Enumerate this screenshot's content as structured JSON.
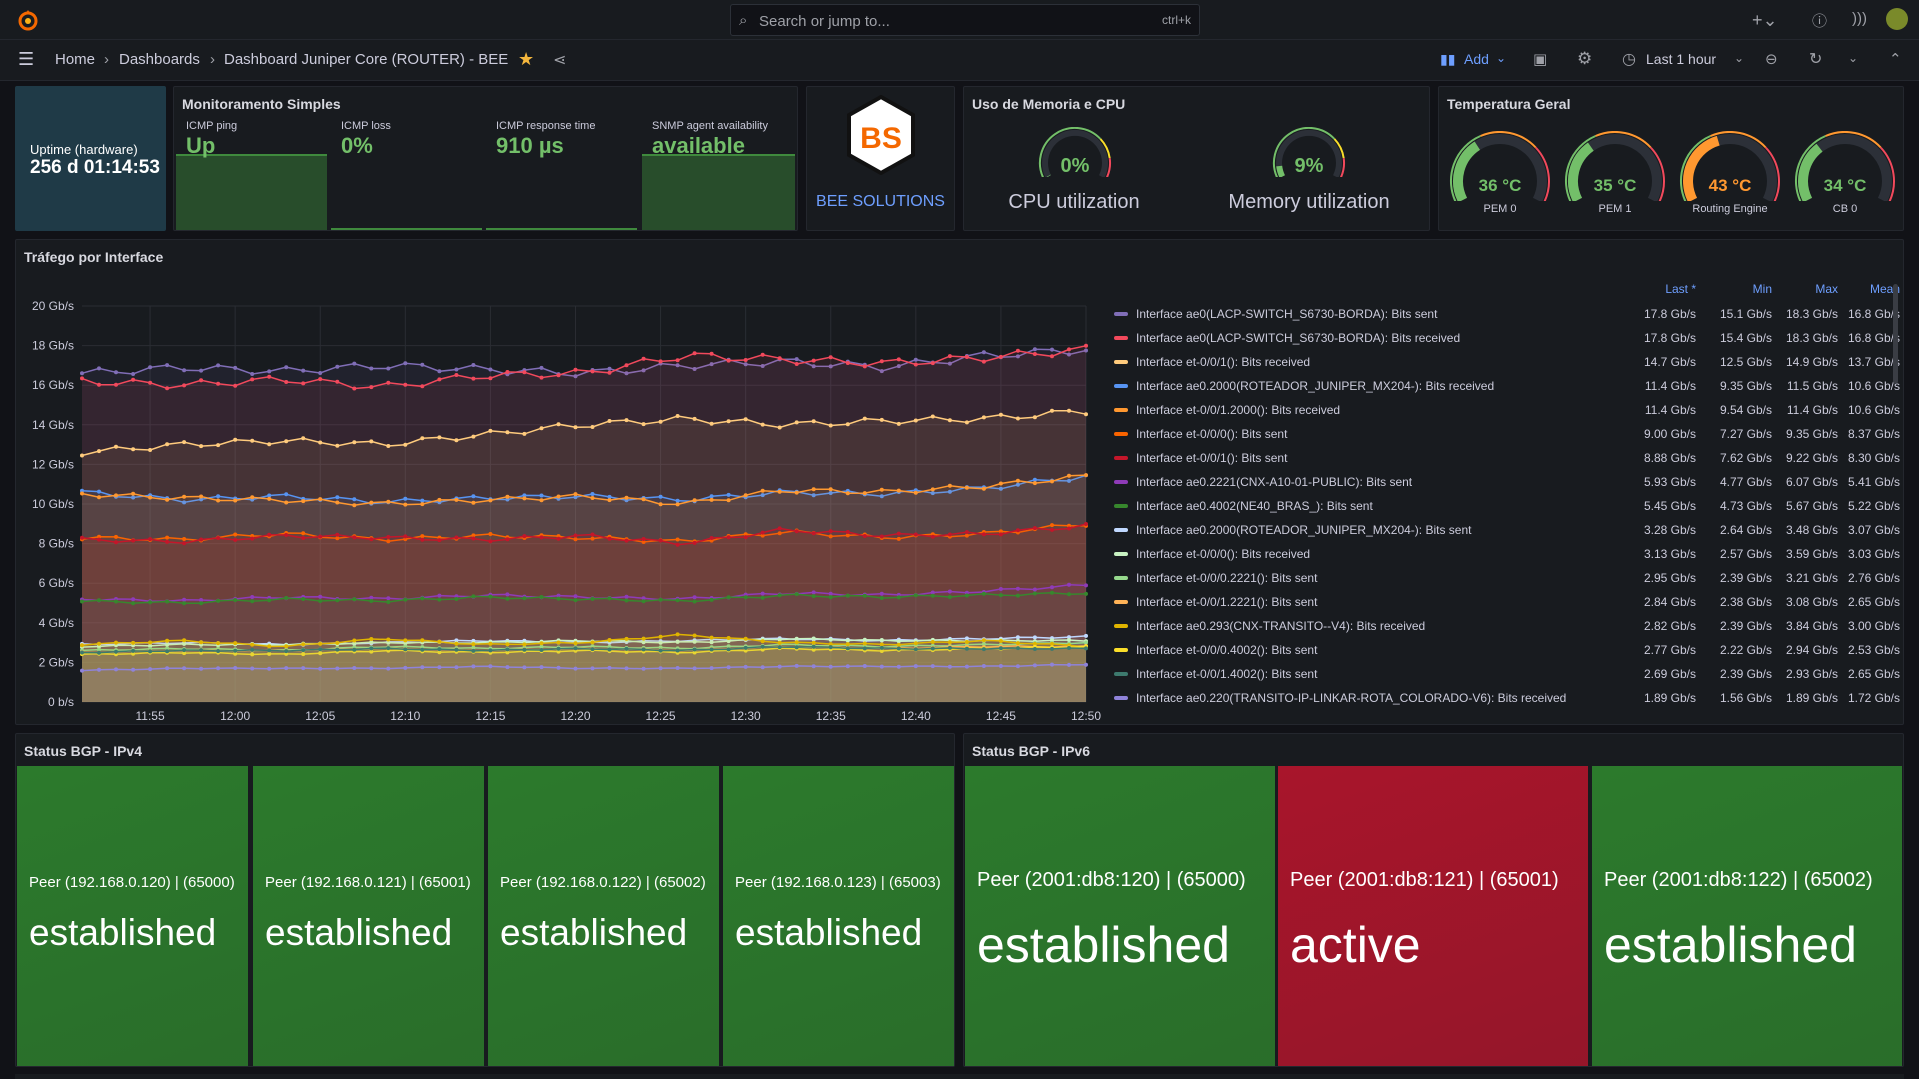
{
  "topbar": {
    "search_placeholder": "Search or jump to...",
    "search_shortcut": "ctrl+k"
  },
  "navbar": {
    "breadcrumb": [
      "Home",
      "Dashboards",
      "Dashboard Juniper Core (ROUTER) - BEE"
    ],
    "add_label": "Add",
    "time_range": "Last 1 hour"
  },
  "uptime": {
    "label": "Uptime (hardware)",
    "value": "256 d 01:14:53"
  },
  "monitoramento": {
    "title": "Monitoramento Simples",
    "stats": [
      {
        "label": "ICMP ping",
        "value": "Up"
      },
      {
        "label": "ICMP loss",
        "value": "0%"
      },
      {
        "label": "ICMP response time",
        "value": "910 µs"
      },
      {
        "label": "SNMP agent availability",
        "value": "available"
      }
    ]
  },
  "brand": {
    "logo_text": "BS",
    "name": "BEE SOLUTIONS"
  },
  "memcpu": {
    "title": "Uso de Memoria e CPU",
    "gauges": [
      {
        "label": "CPU utilization",
        "value": "0%",
        "percent": 0
      },
      {
        "label": "Memory utilization",
        "value": "9%",
        "percent": 9
      }
    ]
  },
  "temperatura": {
    "title": "Temperatura Geral",
    "gauges": [
      {
        "label": "PEM 0",
        "value": "36 °C",
        "percent": 36,
        "color": "#73bf69"
      },
      {
        "label": "PEM 1",
        "value": "35 °C",
        "percent": 35,
        "color": "#73bf69"
      },
      {
        "label": "Routing Engine",
        "value": "43 °C",
        "percent": 43,
        "color": "#ff9830"
      },
      {
        "label": "CB 0",
        "value": "34 °C",
        "percent": 34,
        "color": "#73bf69"
      }
    ]
  },
  "trafego": {
    "title": "Tráfego por Interface",
    "legend_headers": [
      "Last *",
      "Min",
      "Max",
      "Mean"
    ],
    "legend": [
      {
        "name": "Interface ae0(LACP-SWITCH_S6730-BORDA): Bits sent",
        "last": "17.8 Gb/s",
        "min": "15.1 Gb/s",
        "max": "18.3 Gb/s",
        "mean": "16.8 Gb/s",
        "color": "#806eb7"
      },
      {
        "name": "Interface ae0(LACP-SWITCH_S6730-BORDA): Bits received",
        "last": "17.8 Gb/s",
        "min": "15.4 Gb/s",
        "max": "18.3 Gb/s",
        "mean": "16.8 Gb/s",
        "color": "#f2495c"
      },
      {
        "name": "Interface et-0/0/1(): Bits received",
        "last": "14.7 Gb/s",
        "min": "12.5 Gb/s",
        "max": "14.9 Gb/s",
        "mean": "13.7 Gb/s",
        "color": "#ffcb7d"
      },
      {
        "name": "Interface ae0.2000(ROTEADOR_JUNIPER_MX204-): Bits received",
        "last": "11.4 Gb/s",
        "min": "9.35 Gb/s",
        "max": "11.5 Gb/s",
        "mean": "10.6 Gb/s",
        "color": "#5794f2"
      },
      {
        "name": "Interface et-0/0/1.2000(): Bits received",
        "last": "11.4 Gb/s",
        "min": "9.54 Gb/s",
        "max": "11.4 Gb/s",
        "mean": "10.6 Gb/s",
        "color": "#ff9830"
      },
      {
        "name": "Interface et-0/0/0(): Bits sent",
        "last": "9.00 Gb/s",
        "min": "7.27 Gb/s",
        "max": "9.35 Gb/s",
        "mean": "8.37 Gb/s",
        "color": "#fa6400"
      },
      {
        "name": "Interface et-0/0/1(): Bits sent",
        "last": "8.88 Gb/s",
        "min": "7.62 Gb/s",
        "max": "9.22 Gb/s",
        "mean": "8.30 Gb/s",
        "color": "#c4162a"
      },
      {
        "name": "Interface ae0.2221(CNX-A10-01-PUBLIC): Bits sent",
        "last": "5.93 Gb/s",
        "min": "4.77 Gb/s",
        "max": "6.07 Gb/s",
        "mean": "5.41 Gb/s",
        "color": "#8f3bb8"
      },
      {
        "name": "Interface ae0.4002(NE40_BRAS_): Bits sent",
        "last": "5.45 Gb/s",
        "min": "4.73 Gb/s",
        "max": "5.67 Gb/s",
        "mean": "5.22 Gb/s",
        "color": "#37872d"
      },
      {
        "name": "Interface ae0.2000(ROTEADOR_JUNIPER_MX204-): Bits sent",
        "last": "3.28 Gb/s",
        "min": "2.64 Gb/s",
        "max": "3.48 Gb/s",
        "mean": "3.07 Gb/s",
        "color": "#c0d8ff"
      },
      {
        "name": "Interface et-0/0/0(): Bits received",
        "last": "3.13 Gb/s",
        "min": "2.57 Gb/s",
        "max": "3.59 Gb/s",
        "mean": "3.03 Gb/s",
        "color": "#c8f2c2"
      },
      {
        "name": "Interface et-0/0/0.2221(): Bits sent",
        "last": "2.95 Gb/s",
        "min": "2.39 Gb/s",
        "max": "3.21 Gb/s",
        "mean": "2.76 Gb/s",
        "color": "#96d98d"
      },
      {
        "name": "Interface et-0/0/1.2221(): Bits sent",
        "last": "2.84 Gb/s",
        "min": "2.38 Gb/s",
        "max": "3.08 Gb/s",
        "mean": "2.65 Gb/s",
        "color": "#ffb357"
      },
      {
        "name": "Interface ae0.293(CNX-TRANSITO--V4): Bits received",
        "last": "2.82 Gb/s",
        "min": "2.39 Gb/s",
        "max": "3.84 Gb/s",
        "mean": "3.00 Gb/s",
        "color": "#e0b400"
      },
      {
        "name": "Interface et-0/0/0.4002(): Bits sent",
        "last": "2.77 Gb/s",
        "min": "2.22 Gb/s",
        "max": "2.94 Gb/s",
        "mean": "2.53 Gb/s",
        "color": "#fade2a"
      },
      {
        "name": "Interface et-0/0/1.4002(): Bits sent",
        "last": "2.69 Gb/s",
        "min": "2.39 Gb/s",
        "max": "2.93 Gb/s",
        "mean": "2.65 Gb/s",
        "color": "#3d7a6e"
      },
      {
        "name": "Interface ae0.220(TRANSITO-IP-LINKAR-ROTA_COLORADO-V6): Bits received",
        "last": "1.89 Gb/s",
        "min": "1.56 Gb/s",
        "max": "1.89 Gb/s",
        "mean": "1.72 Gb/s",
        "color": "#8f83d9"
      }
    ]
  },
  "chart_data": {
    "type": "area",
    "title": "Tráfego por Interface",
    "xlabel": "",
    "ylabel": "",
    "x": [
      "11:55",
      "12:00",
      "12:05",
      "12:10",
      "12:15",
      "12:20",
      "12:25",
      "12:30",
      "12:35",
      "12:40",
      "12:45",
      "12:50"
    ],
    "y_ticks": [
      "0 b/s",
      "2 Gb/s",
      "4 Gb/s",
      "6 Gb/s",
      "8 Gb/s",
      "10 Gb/s",
      "12 Gb/s",
      "14 Gb/s",
      "16 Gb/s",
      "18 Gb/s",
      "20 Gb/s"
    ],
    "ylim": [
      0,
      20
    ],
    "y_unit": "Gb/s",
    "x_range": [
      "11:51",
      "12:50"
    ],
    "series": [
      {
        "name": "Interface ae0(LACP-SWITCH_S6730-BORDA): Bits sent",
        "color": "#806eb7",
        "values": [
          16.6,
          16.9,
          16.7,
          17.0,
          16.8,
          16.6,
          17.0,
          17.2,
          16.9,
          17.5,
          17.8
        ]
      },
      {
        "name": "Interface ae0(LACP-SWITCH_S6730-BORDA): Bits received",
        "color": "#f2495c",
        "values": [
          16.2,
          16.0,
          16.3,
          15.9,
          16.5,
          16.6,
          17.5,
          17.3,
          17.1,
          17.4,
          17.8
        ]
      },
      {
        "name": "Interface et-0/0/1(): Bits received",
        "color": "#ffcb7d",
        "values": [
          12.6,
          13.0,
          13.2,
          13.0,
          13.5,
          14.0,
          14.3,
          14.0,
          14.2,
          14.3,
          14.7
        ]
      },
      {
        "name": "Interface ae0.2000(ROTEADOR_JUNIPER_MX204-): Bits received",
        "color": "#5794f2",
        "values": [
          10.6,
          10.2,
          10.4,
          10.1,
          10.3,
          10.4,
          10.2,
          10.6,
          10.5,
          10.8,
          11.4
        ]
      },
      {
        "name": "Interface et-0/0/1.2000(): Bits received",
        "color": "#ff9830",
        "values": [
          10.5,
          10.3,
          10.2,
          10.0,
          10.2,
          10.4,
          10.0,
          10.7,
          10.6,
          10.9,
          11.4
        ]
      },
      {
        "name": "Interface et-0/0/0(): Bits sent",
        "color": "#fa6400",
        "values": [
          8.3,
          8.2,
          8.5,
          8.2,
          8.4,
          8.3,
          8.1,
          8.6,
          8.3,
          8.5,
          9.0
        ]
      },
      {
        "name": "Interface et-0/0/1(): Bits sent",
        "color": "#c4162a",
        "values": [
          8.2,
          8.1,
          8.4,
          8.3,
          8.2,
          8.4,
          8.0,
          8.7,
          8.4,
          8.5,
          8.9
        ]
      },
      {
        "name": "Interface ae0.2221(CNX-A10-01-PUBLIC): Bits sent",
        "color": "#8f3bb8",
        "values": [
          5.2,
          5.1,
          5.3,
          5.2,
          5.4,
          5.3,
          5.2,
          5.5,
          5.4,
          5.6,
          5.9
        ]
      },
      {
        "name": "Interface ae0.4002(NE40_BRAS_): Bits sent",
        "color": "#37872d",
        "values": [
          5.1,
          5.0,
          5.2,
          5.1,
          5.3,
          5.2,
          5.1,
          5.4,
          5.3,
          5.4,
          5.5
        ]
      },
      {
        "name": "Interface ae0.2000(ROTEADOR_JUNIPER_MX204-): Bits sent",
        "color": "#c0d8ff",
        "values": [
          2.9,
          3.0,
          2.9,
          3.0,
          3.1,
          3.0,
          3.1,
          3.2,
          3.1,
          3.2,
          3.3
        ]
      },
      {
        "name": "Interface et-0/0/0(): Bits received",
        "color": "#c8f2c2",
        "values": [
          2.8,
          2.9,
          2.9,
          3.0,
          3.0,
          3.1,
          3.0,
          3.2,
          3.1,
          3.1,
          3.1
        ]
      },
      {
        "name": "Interface et-0/0/0.2221(): Bits sent",
        "color": "#96d98d",
        "values": [
          2.6,
          2.7,
          2.6,
          2.8,
          2.7,
          2.8,
          2.7,
          2.9,
          2.8,
          2.9,
          3.0
        ]
      },
      {
        "name": "Interface et-0/0/1.2221(): Bits sent",
        "color": "#ffb357",
        "values": [
          2.5,
          2.6,
          2.6,
          2.7,
          2.6,
          2.7,
          2.6,
          2.8,
          2.7,
          2.8,
          2.8
        ]
      },
      {
        "name": "Interface ae0.293(CNX-TRANSITO--V4): Bits received",
        "color": "#e0b400",
        "values": [
          2.9,
          3.1,
          2.8,
          3.2,
          2.9,
          3.0,
          3.4,
          3.0,
          2.9,
          3.1,
          2.8
        ]
      },
      {
        "name": "Interface et-0/0/0.4002(): Bits sent",
        "color": "#fade2a",
        "values": [
          2.4,
          2.5,
          2.4,
          2.6,
          2.5,
          2.6,
          2.5,
          2.7,
          2.6,
          2.7,
          2.8
        ]
      },
      {
        "name": "Interface et-0/0/1.4002(): Bits sent",
        "color": "#3d7a6e",
        "values": [
          2.5,
          2.6,
          2.6,
          2.7,
          2.6,
          2.7,
          2.6,
          2.8,
          2.7,
          2.7,
          2.7
        ]
      },
      {
        "name": "Interface ae0.220(TRANSITO-IP-LINKAR-ROTA_COLORADO-V6): Bits received",
        "color": "#8f83d9",
        "values": [
          1.6,
          1.7,
          1.7,
          1.7,
          1.8,
          1.7,
          1.7,
          1.8,
          1.8,
          1.8,
          1.9
        ]
      }
    ]
  },
  "bgp_v4": {
    "title": "Status BGP - IPv4",
    "peers": [
      {
        "label": "Peer (192.168.0.120) | (65000)",
        "status": "established",
        "color": "#2c7a2c"
      },
      {
        "label": "Peer (192.168.0.121) | (65001)",
        "status": "established",
        "color": "#2c7a2c"
      },
      {
        "label": "Peer (192.168.0.122) | (65002)",
        "status": "established",
        "color": "#2c7a2c"
      },
      {
        "label": "Peer (192.168.0.123) | (65003)",
        "status": "established",
        "color": "#2c7a2c"
      }
    ]
  },
  "bgp_v6": {
    "title": "Status BGP - IPv6",
    "peers": [
      {
        "label": "Peer (2001:db8:120) | (65000)",
        "status": "established",
        "color": "#2c7a2c"
      },
      {
        "label": "Peer (2001:db8:121) | (65001)",
        "status": "active",
        "color": "#a8152b"
      },
      {
        "label": "Peer (2001:db8:122) | (65002)",
        "status": "established",
        "color": "#2c7a2c"
      }
    ]
  }
}
